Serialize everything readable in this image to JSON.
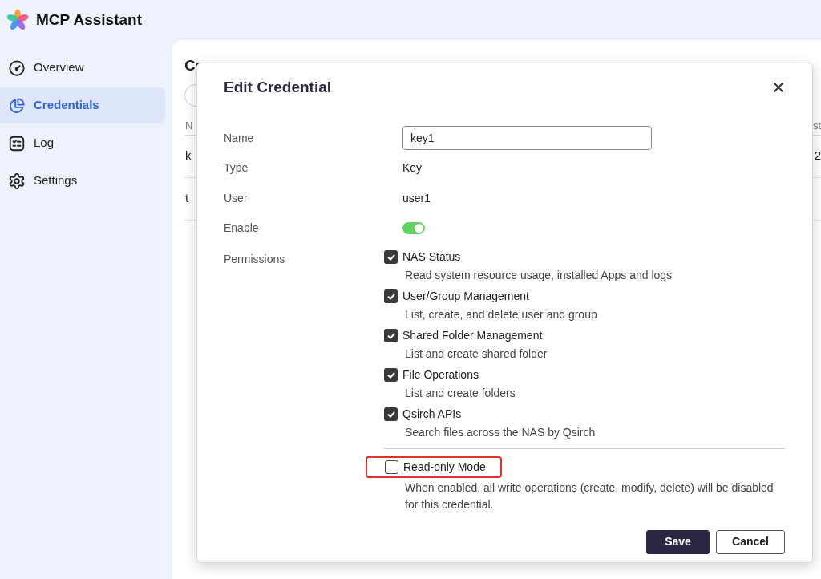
{
  "app": {
    "title": "MCP Assistant"
  },
  "sidebar": {
    "items": [
      {
        "label": "Overview",
        "kind": "gauge",
        "selected": false
      },
      {
        "label": "Credentials",
        "kind": "pie",
        "selected": true
      },
      {
        "label": "Log",
        "kind": "list",
        "selected": false
      },
      {
        "label": "Settings",
        "kind": "gear",
        "selected": false
      }
    ]
  },
  "page": {
    "heading": "Cr",
    "table_header": [
      "N",
      "st"
    ],
    "rows": [
      [
        "k",
        "2"
      ],
      [
        "t"
      ]
    ]
  },
  "dialog": {
    "title": "Edit Credential",
    "fields": [
      {
        "kind": "input",
        "label": "Name",
        "value": "key1"
      },
      {
        "kind": "text",
        "label": "Type",
        "value": "Key"
      },
      {
        "kind": "text",
        "label": "User",
        "value": "user1"
      },
      {
        "kind": "toggle",
        "label": "Enable",
        "on": true
      }
    ],
    "permissions": {
      "label": "Permissions",
      "items": [
        {
          "label": "NAS Status",
          "description": "Read system resource usage, installed Apps and logs",
          "checked": true
        },
        {
          "label": "User/Group Management",
          "description": "List, create, and delete user and group",
          "checked": true
        },
        {
          "label": "Shared Folder Management",
          "description": "List and create shared folder",
          "checked": true
        },
        {
          "label": "File Operations",
          "description": "List and create folders",
          "checked": true
        },
        {
          "label": "Qsirch APIs",
          "description": "Search files across the NAS by Qsirch",
          "checked": true
        }
      ]
    },
    "read_only": {
      "label": "Read-only Mode",
      "checked": false,
      "highlighted": true,
      "description": "When enabled, all write operations (create, modify, delete) will be disabled for this credential."
    },
    "buttons": [
      {
        "label": "Save",
        "kind": "primary"
      },
      {
        "label": "Cancel",
        "kind": "secondary"
      }
    ]
  }
}
